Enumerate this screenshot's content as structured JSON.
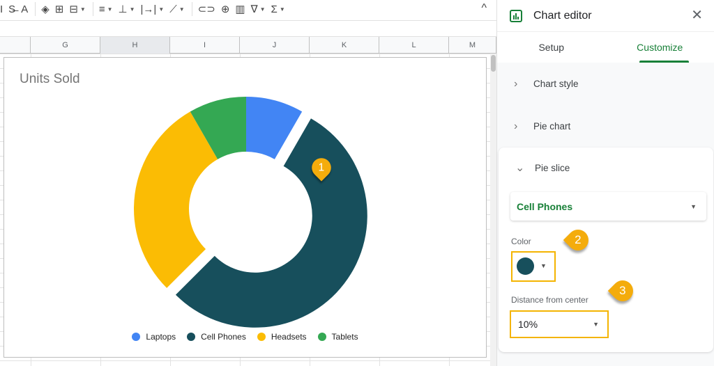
{
  "toolbar": {
    "items": [
      {
        "icon": "italic-icon",
        "glyph": "I"
      },
      {
        "icon": "strikethrough-icon",
        "glyph": "S̶"
      },
      {
        "icon": "text-color-icon",
        "glyph": "A"
      },
      {
        "icon": "fill-color-icon",
        "glyph": "◈"
      },
      {
        "icon": "borders-icon",
        "glyph": "⊞"
      },
      {
        "icon": "merge-cells-icon",
        "glyph": "⊟"
      },
      {
        "icon": "horizontal-align-icon",
        "glyph": "≡"
      },
      {
        "icon": "vertical-align-icon",
        "glyph": "⊥"
      },
      {
        "icon": "text-wrapping-icon",
        "glyph": "|→|"
      },
      {
        "icon": "text-rotation-icon",
        "glyph": "⟋"
      },
      {
        "icon": "insert-link-icon",
        "glyph": "⊂⊃"
      },
      {
        "icon": "insert-comment-icon",
        "glyph": "⊕"
      },
      {
        "icon": "insert-chart-icon",
        "glyph": "▥"
      },
      {
        "icon": "filter-icon",
        "glyph": "∇"
      },
      {
        "icon": "functions-icon",
        "glyph": "Σ"
      }
    ],
    "collapse_glyph": "^"
  },
  "columns": [
    "",
    "G",
    "H",
    "I",
    "J",
    "K",
    "L",
    "M"
  ],
  "chart_data": {
    "type": "pie",
    "donut": true,
    "title": "Units Sold",
    "categories": [
      "Laptops",
      "Cell Phones",
      "Headsets",
      "Tablets"
    ],
    "values": [
      8.3,
      54.2,
      29.2,
      8.3
    ],
    "value_units": "percent of total (estimated from slice angles)",
    "colors": [
      "#4285f4",
      "#174f5c",
      "#fbbc04",
      "#34a853"
    ],
    "exploded": {
      "Cell Phones": 0.1
    },
    "legend_position": "bottom"
  },
  "panel": {
    "title": "Chart editor",
    "close_glyph": "✕",
    "tabs": [
      {
        "label": "Setup"
      },
      {
        "label": "Customize",
        "active": true
      }
    ],
    "sections": [
      {
        "label": "Chart style",
        "expanded": false
      },
      {
        "label": "Pie chart",
        "expanded": false
      },
      {
        "label": "Pie slice",
        "expanded": true
      }
    ],
    "pie_slice": {
      "selected_slice": "Cell Phones",
      "color_label": "Color",
      "color_value": "#174f5c",
      "distance_label": "Distance from center",
      "distance_value": "10%"
    }
  },
  "markers": [
    "1",
    "2",
    "3"
  ],
  "caret": "▼",
  "chev_right": "›",
  "chev_down": "⌄"
}
